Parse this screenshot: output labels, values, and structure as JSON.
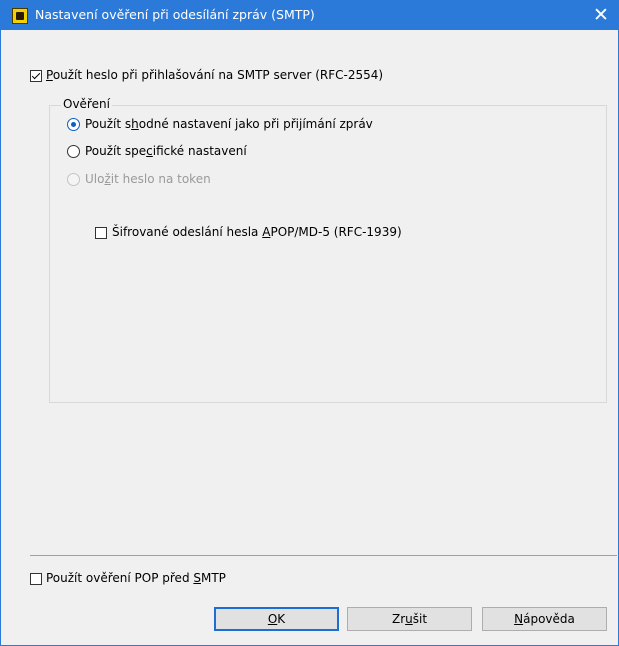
{
  "window": {
    "title": "Nastavení ověření při odesílání zpráv (SMTP)",
    "close_glyph": "✕",
    "app_icon": "app-icon",
    "titlebar_color": "#2b79d8"
  },
  "use_password": {
    "checked": true,
    "pre": "",
    "accel": "P",
    "post": "oužít heslo při přihlašování na SMTP server (RFC-2554)"
  },
  "auth_group": {
    "legend": "Ověření",
    "options": [
      {
        "pre": "Použít s",
        "accel": "h",
        "post": "odné nastavení jako při přijímání zpráv",
        "selected": true,
        "enabled": true
      },
      {
        "pre": "Použít spe",
        "accel": "c",
        "post": "ifické nastavení",
        "selected": false,
        "enabled": true
      },
      {
        "pre": "Ulo",
        "accel": "ž",
        "post": "it heslo na token",
        "selected": false,
        "enabled": false
      }
    ],
    "apop": {
      "checked": false,
      "pre": "Šifrované odeslání hesla ",
      "accel": "A",
      "post": "POP/MD-5 (RFC-1939)"
    }
  },
  "pop_before_smtp": {
    "checked": false,
    "pre": "Použít ověření POP před ",
    "accel": "S",
    "post": "MTP"
  },
  "buttons": {
    "ok": {
      "pre": "",
      "accel": "O",
      "post": "K"
    },
    "cancel": {
      "pre": "Zr",
      "accel": "u",
      "post": "šit"
    },
    "help": {
      "pre": "",
      "accel": "N",
      "post": "ápověda"
    }
  }
}
